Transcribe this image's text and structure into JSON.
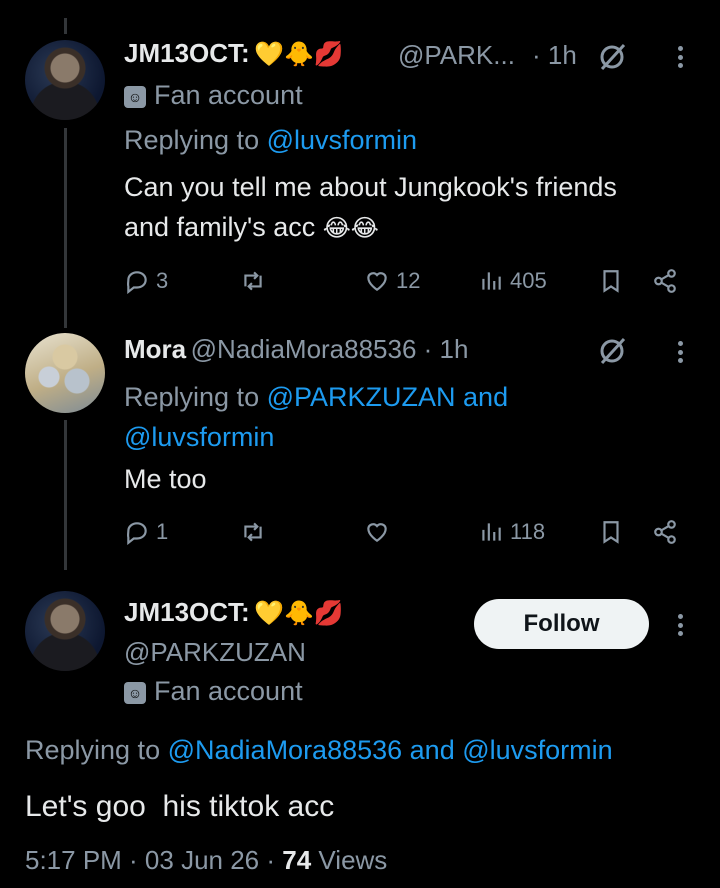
{
  "tweet1": {
    "display_name": "JM13OCT:",
    "name_emojis": "💛🐥💋",
    "handle": "@PARK...",
    "time": "· 1h",
    "badge_label": "Fan account",
    "replying_prefix": "Replying to",
    "replying_to": "@luvsformin",
    "text_line1": "Can you tell me about Jungkook's friends",
    "text_line2": "and family's acc",
    "text_emojis": "😂😂",
    "replies": "3",
    "retweets": "",
    "likes": "12",
    "views": "405"
  },
  "tweet2": {
    "display_name": "Mora",
    "handle": "@NadiaMora88536 · 1h",
    "replying_prefix": "Replying to",
    "replying_to_line1": "@PARKZUZAN and",
    "replying_to_line2": "@luvsformin",
    "text": "Me too",
    "replies": "1",
    "likes": "",
    "views": "118"
  },
  "main_tweet": {
    "display_name": "JM13OCT:",
    "name_emojis": "💛🐥💋",
    "handle": "@PARKZUZAN",
    "badge_label": "Fan account",
    "follow_label": "Follow",
    "replying_prefix": "Replying to",
    "replying_to": "@NadiaMora88536 and @luvsformin",
    "text": "Let's goo  his tiktok acc",
    "timestamp": "5:17 PM · 03 Jun 26 ·",
    "views_count": "74",
    "views_label": "Views"
  }
}
